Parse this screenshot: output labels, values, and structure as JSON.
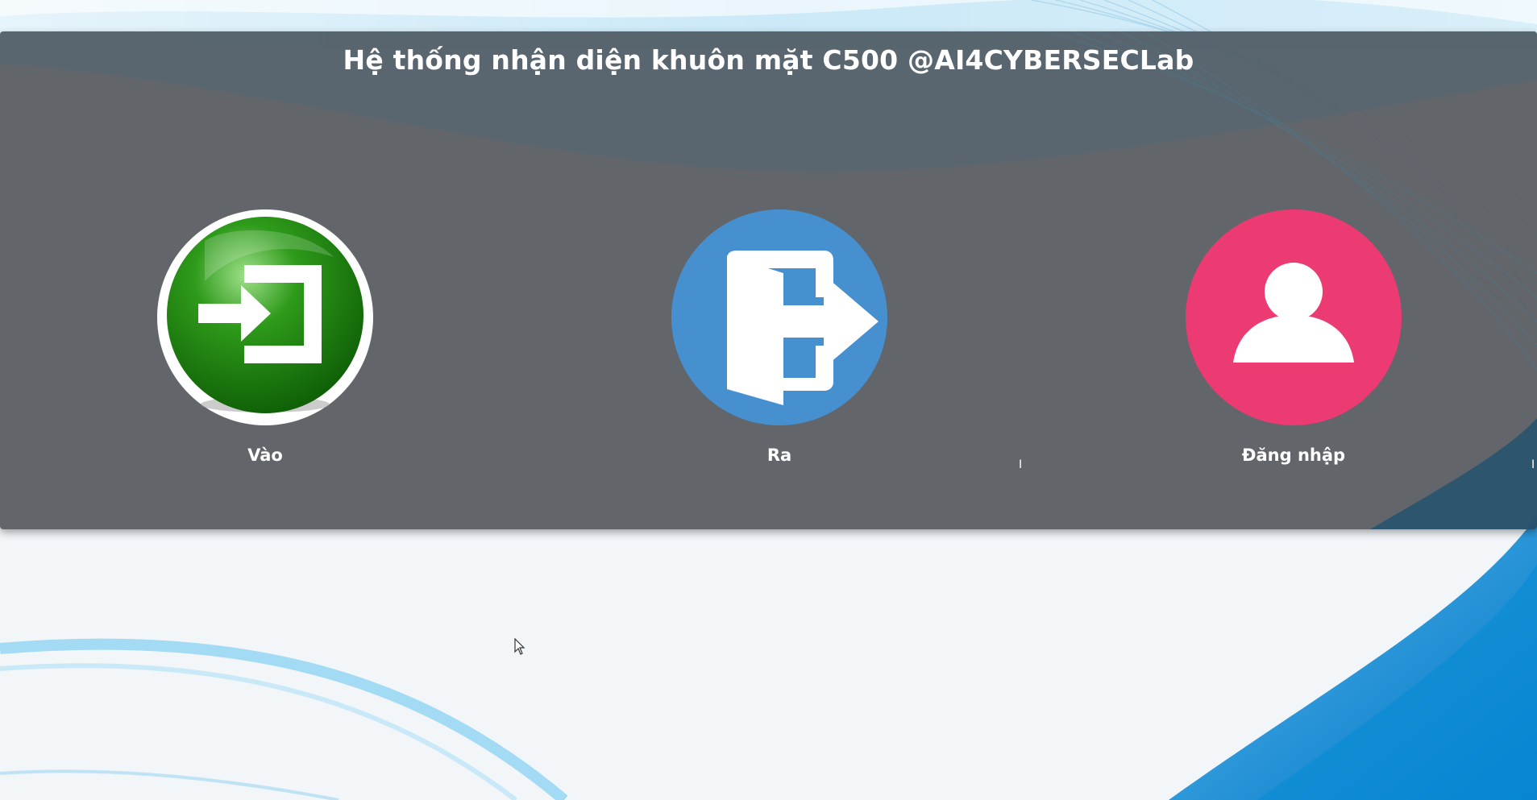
{
  "header": {
    "title": "Hệ thống nhận diện khuôn mặt C500 @AI4CYBERSECLab"
  },
  "actions": [
    {
      "label": "Vào",
      "icon": "enter-icon",
      "color": "#1e7a0e"
    },
    {
      "label": "Ra",
      "icon": "exit-door-icon",
      "color": "#4690d0"
    },
    {
      "label": "Đăng nhập",
      "icon": "user-icon",
      "color": "#ec3a72"
    }
  ],
  "colors": {
    "panel": "#5b5e63",
    "background": "#f2f6f9",
    "accent_blue": "#0a8bd6"
  }
}
